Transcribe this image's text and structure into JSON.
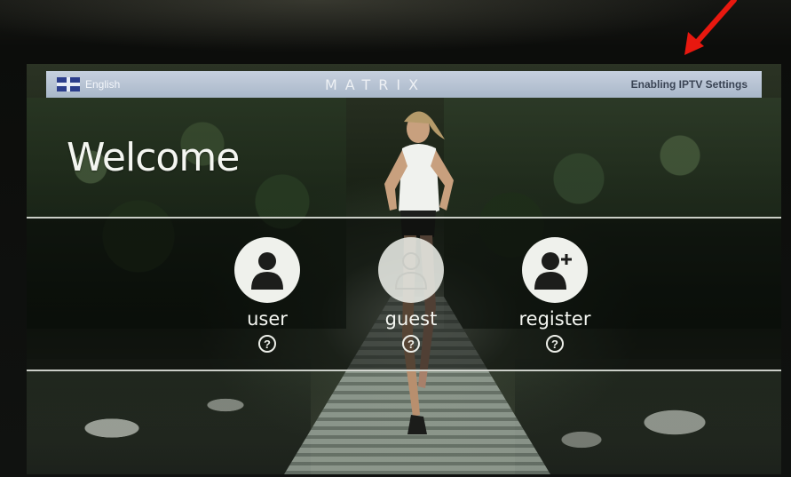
{
  "header": {
    "language_label": "English",
    "brand": "MATRIX",
    "iptv_settings_label": "Enabling IPTV Settings"
  },
  "main": {
    "welcome_title": "Welcome",
    "profiles": [
      {
        "label": "user",
        "help": "?",
        "icon": "person-icon"
      },
      {
        "label": "guest",
        "help": "?",
        "icon": "person-outline-icon"
      },
      {
        "label": "register",
        "help": "?",
        "icon": "person-add-icon"
      }
    ]
  },
  "annotation": {
    "arrow_color": "#e8180f"
  },
  "colors": {
    "header_bar": "#b8c4d4",
    "text_light": "#f4f6f1",
    "icon_dark": "#1c1d1b"
  }
}
